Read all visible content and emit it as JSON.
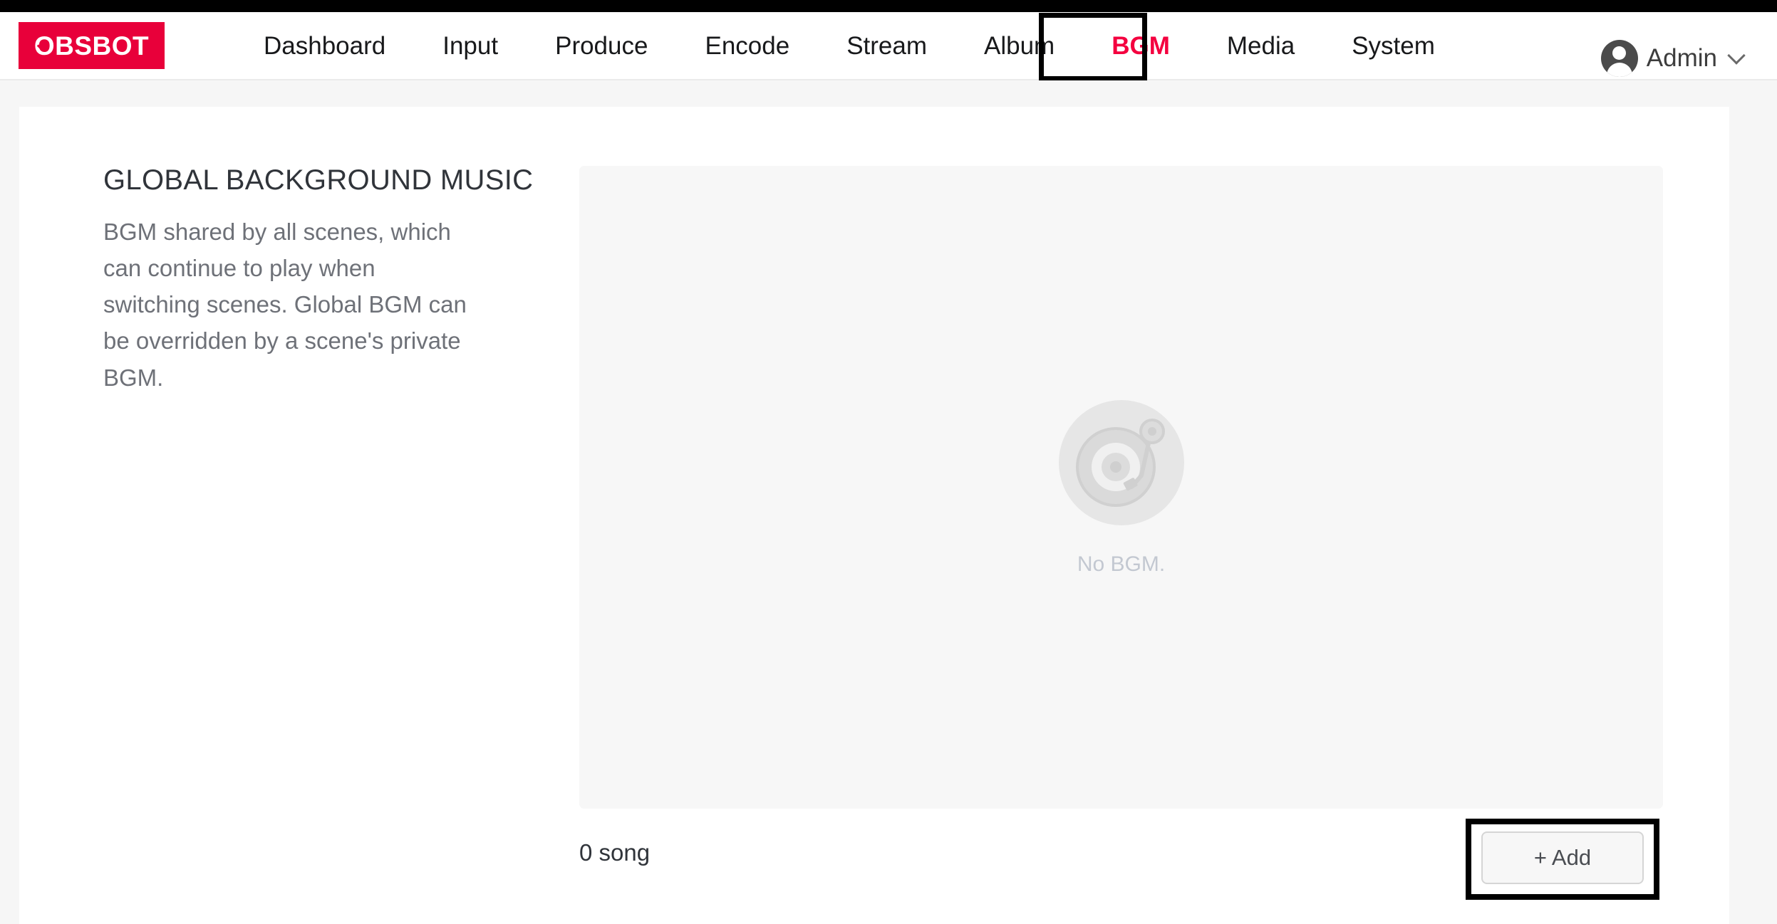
{
  "brand": {
    "logo_text": "OBSBOT",
    "logo_color": "#e8003a"
  },
  "nav": {
    "items": [
      {
        "label": "Dashboard",
        "active": false
      },
      {
        "label": "Input",
        "active": false
      },
      {
        "label": "Produce",
        "active": false
      },
      {
        "label": "Encode",
        "active": false
      },
      {
        "label": "Stream",
        "active": false
      },
      {
        "label": "Album",
        "active": false
      },
      {
        "label": "BGM",
        "active": true
      },
      {
        "label": "Media",
        "active": false
      },
      {
        "label": "System",
        "active": false
      }
    ],
    "active_label": "BGM",
    "active_color": "#f4003f"
  },
  "account": {
    "name": "Admin",
    "avatar_icon": "user-avatar-icon",
    "chevron_icon": "chevron-down-icon"
  },
  "main": {
    "section_title": "GLOBAL BACKGROUND MUSIC",
    "section_description": "BGM shared by all scenes, which can continue to play when switching scenes. Global BGM can be overridden by a scene's private BGM.",
    "empty_state": {
      "icon": "turntable-record-icon",
      "text": "No BGM."
    },
    "song_count_label": "0 song",
    "add_button_label": "+ Add"
  }
}
